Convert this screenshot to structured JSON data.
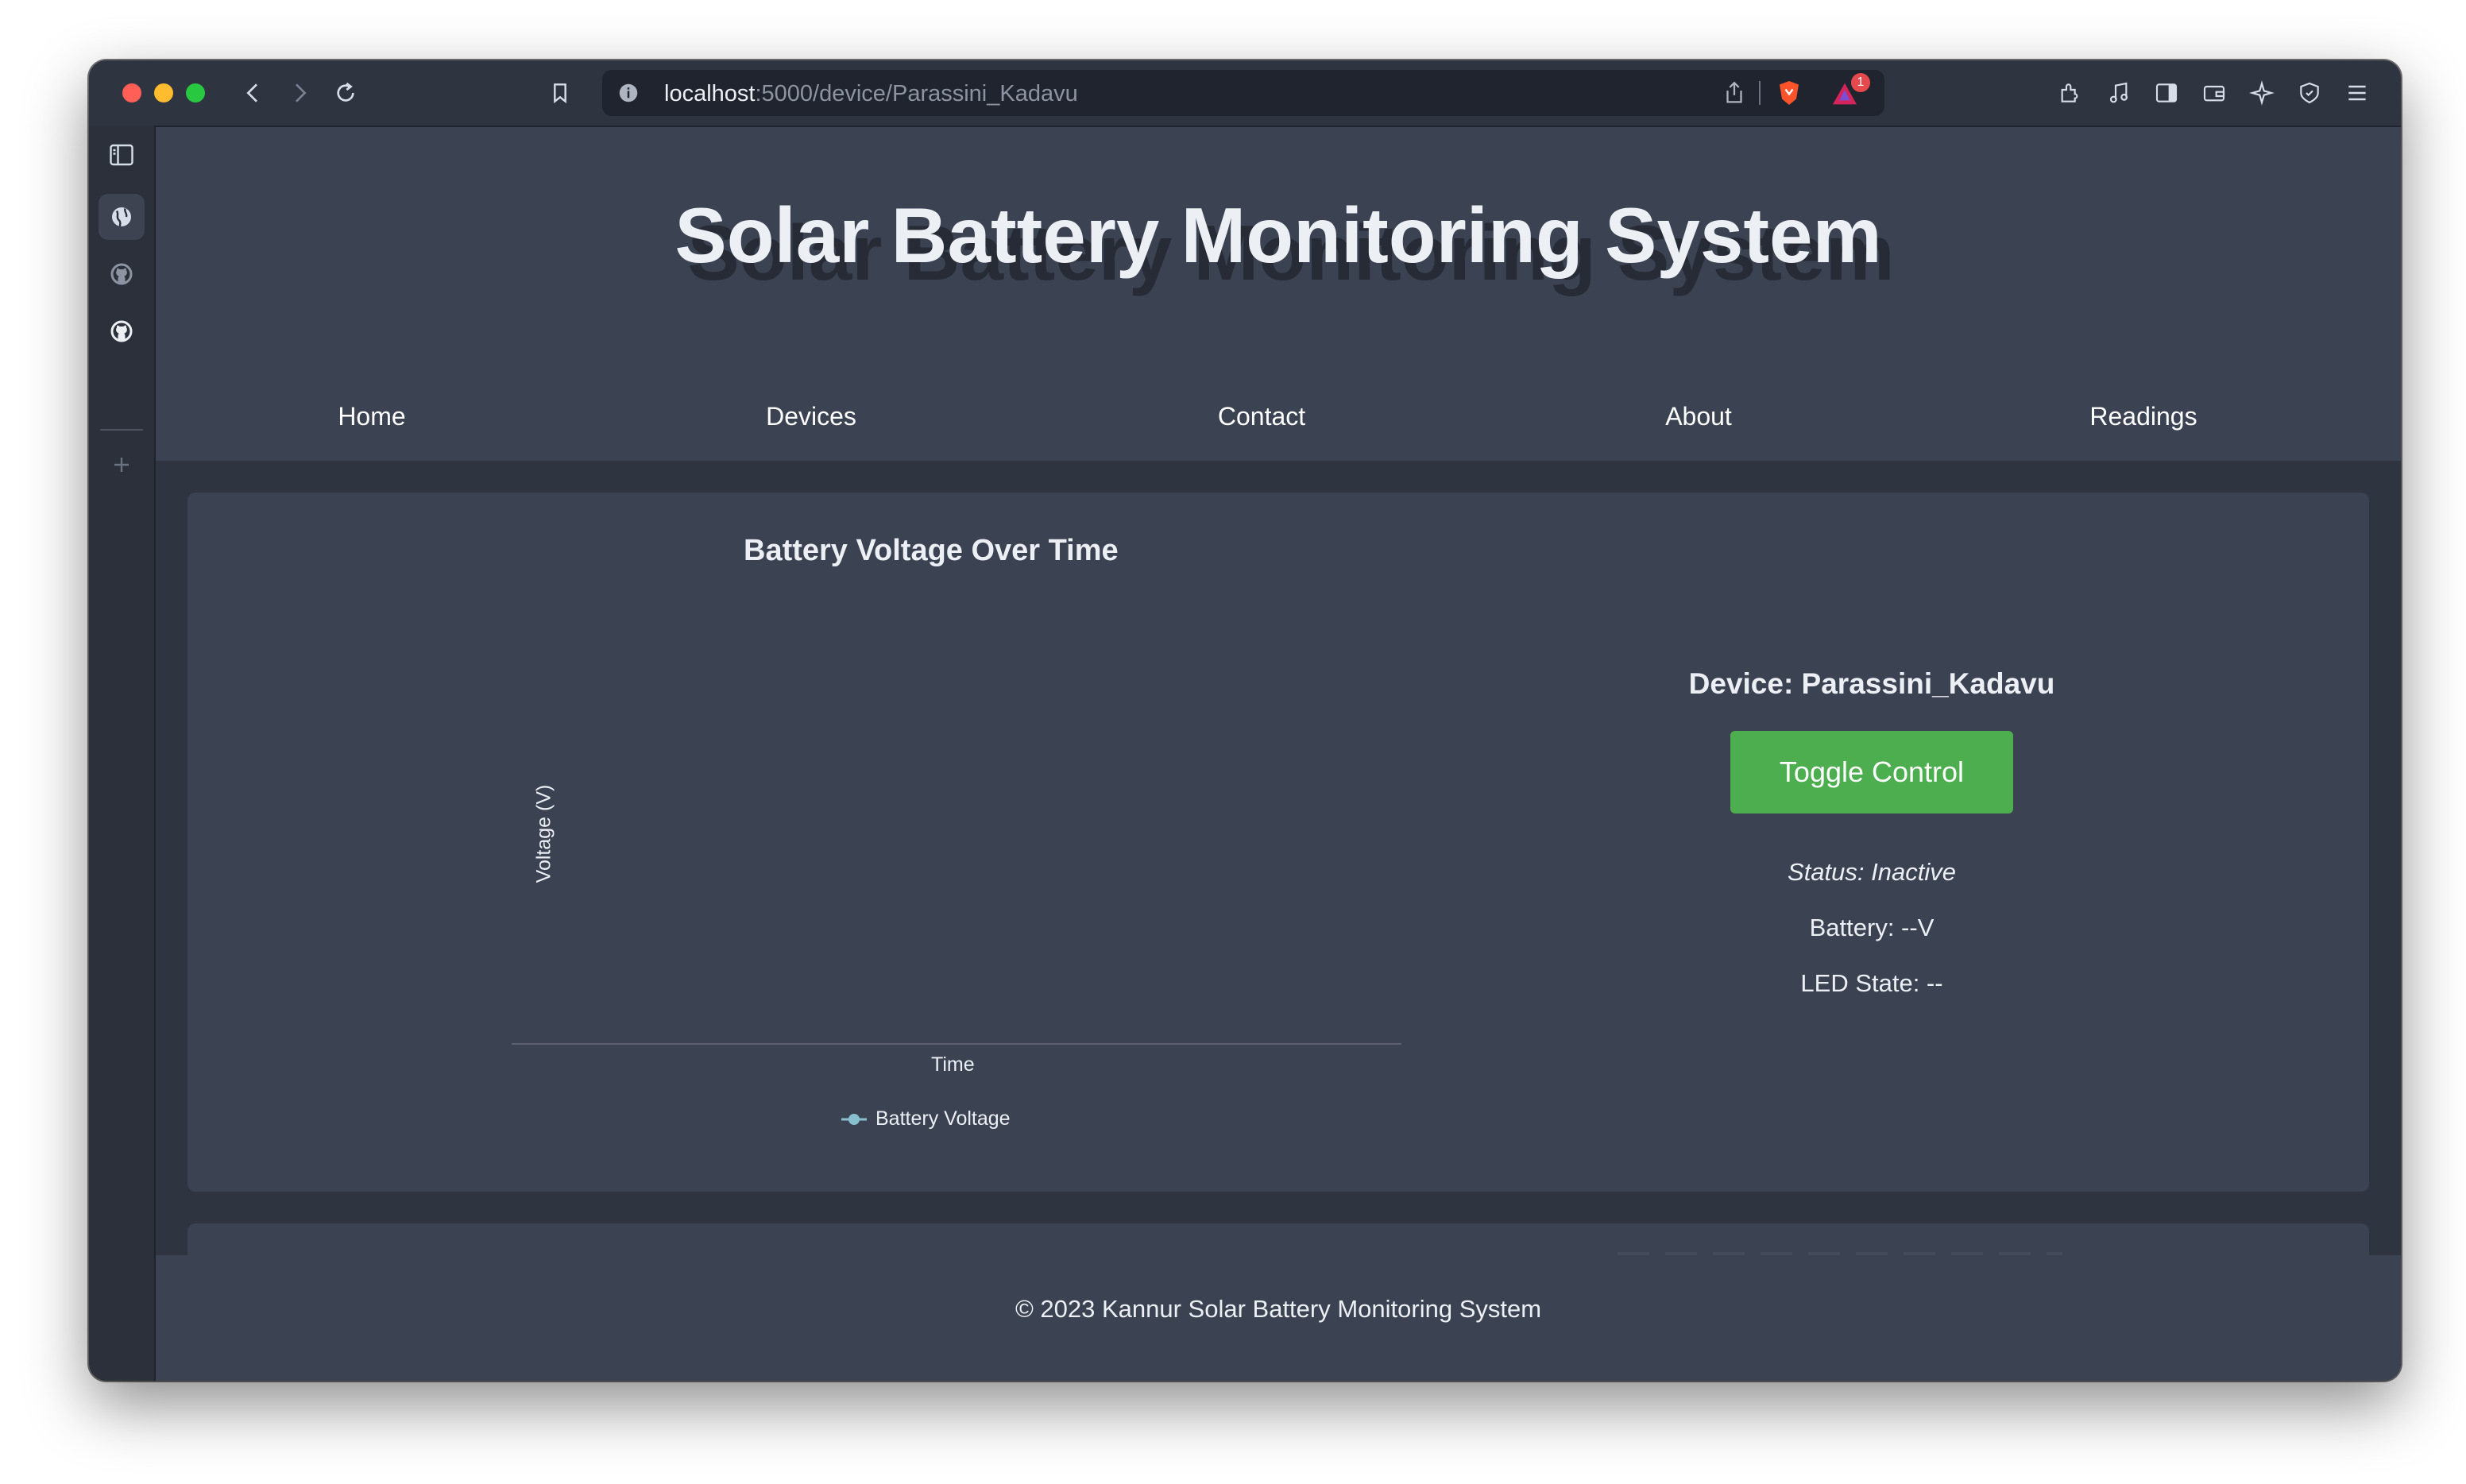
{
  "browser": {
    "url_host": "localhost",
    "url_path": ":5000/device/Parassini_Kadavu",
    "notification_count": "1"
  },
  "site": {
    "title": "Solar Battery Monitoring System"
  },
  "nav": {
    "items": [
      {
        "label": "Home"
      },
      {
        "label": "Devices"
      },
      {
        "label": "Contact"
      },
      {
        "label": "About"
      },
      {
        "label": "Readings"
      }
    ]
  },
  "chart_data": {
    "type": "line",
    "title": "Battery Voltage Over Time",
    "xlabel": "Time",
    "ylabel": "Voltage (V)",
    "series": [
      {
        "name": "Battery Voltage",
        "values": [],
        "color": "#88c0d0"
      }
    ],
    "x": [],
    "legend": "bottom"
  },
  "device": {
    "title": "Device: Parassini_Kadavu",
    "toggle_label": "Toggle Control",
    "status": "Status: Inactive",
    "battery": "Battery: --V",
    "led_state": "LED State: --",
    "button_color": "#4cae4f"
  },
  "footer": {
    "text": "© 2023 Kannur Solar Battery Monitoring System"
  }
}
